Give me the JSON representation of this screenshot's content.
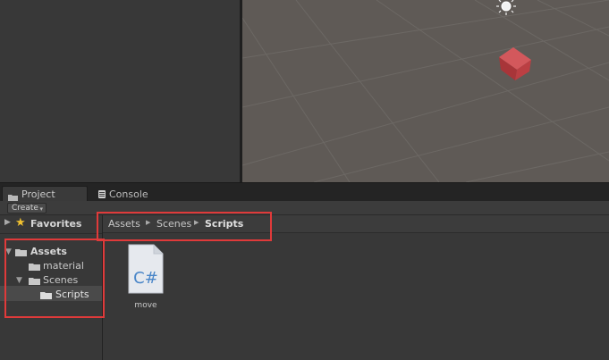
{
  "tabs": [
    {
      "label": "Project",
      "active": true
    },
    {
      "label": "Console",
      "active": false
    }
  ],
  "toolbar": {
    "create_label": "Create"
  },
  "favorites": {
    "label": "Favorites"
  },
  "tree": [
    {
      "label": "Assets",
      "bold": true
    },
    {
      "label": "material"
    },
    {
      "label": "Scenes"
    },
    {
      "label": "Scripts",
      "selected": true
    }
  ],
  "breadcrumb": [
    "Assets",
    "Scenes",
    "Scripts"
  ],
  "files": [
    {
      "label": "move",
      "icon_text": "C#"
    }
  ],
  "colors": {
    "annotation": "#e03a3a",
    "cube": "#c7464a",
    "scene_bg": "#5f5a56",
    "cs_icon_text": "#4a86c8"
  }
}
